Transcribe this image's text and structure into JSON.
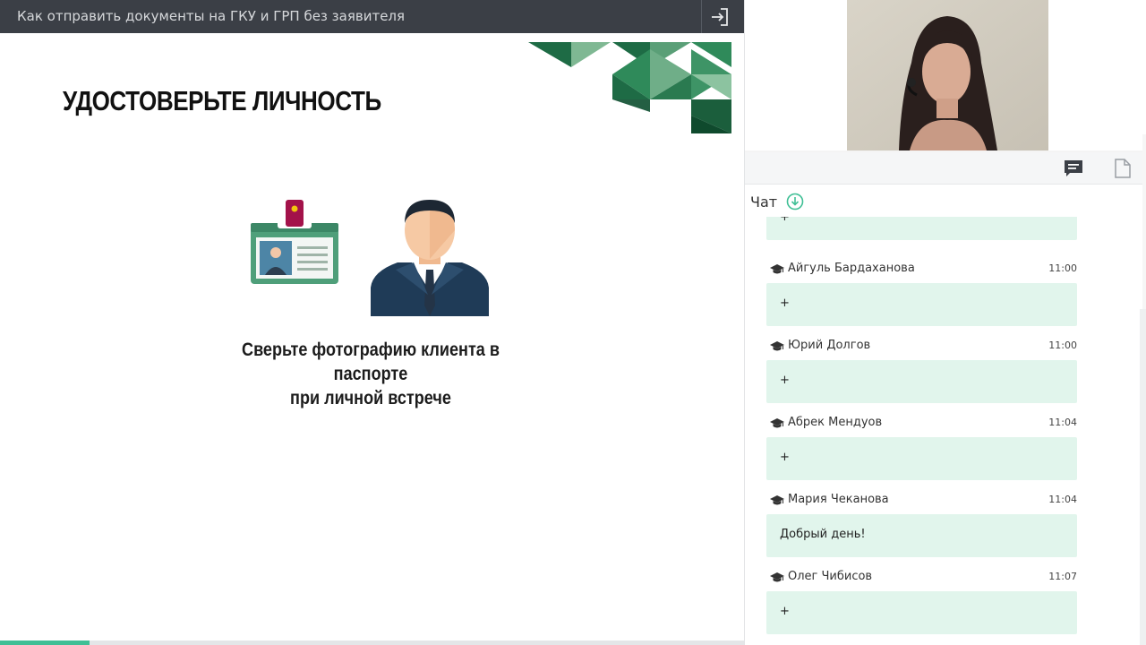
{
  "topbar": {
    "title": "Как отправить документы на ГКУ и ГРП без заявителя",
    "exit_icon": "exit-icon"
  },
  "slide": {
    "title": "УДОСТОВЕРЬТЕ ЛИЧНОСТЬ",
    "caption_line1": "Сверьте фотографию клиента в паспорте",
    "caption_line2": "при личной встрече",
    "colors": {
      "green_dark": "#1e6b45",
      "green_mid": "#2f8a5a",
      "green_light": "#7fb893",
      "card_green": "#4f9f7a",
      "lanyard": "#a3124a"
    }
  },
  "progress": {
    "fraction": 0.12,
    "color": "#3fbf95"
  },
  "toolbar": {
    "chat_icon": "chat-icon",
    "file_icon": "file-icon"
  },
  "chat": {
    "title": "Чат",
    "download_icon": "download-circle-icon",
    "accent": "#3fbf95",
    "bubble_color": "#e1f5ec",
    "messages": [
      {
        "author": "",
        "time": "",
        "text": "+"
      },
      {
        "author": "Айгуль Бардаханова",
        "time": "11:00",
        "text": "+"
      },
      {
        "author": "Юрий Долгов",
        "time": "11:00",
        "text": "+"
      },
      {
        "author": "Абрек Мендуов",
        "time": "11:04",
        "text": "+"
      },
      {
        "author": "Мария Чеканова",
        "time": "11:04",
        "text": "Добрый день!"
      },
      {
        "author": "Олег Чибисов",
        "time": "11:07",
        "text": "+"
      }
    ]
  }
}
